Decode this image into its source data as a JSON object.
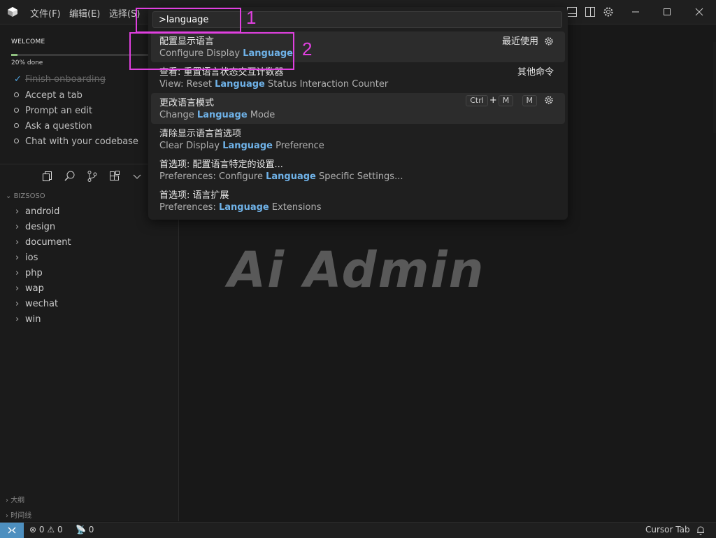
{
  "titlebar": {
    "menus": [
      "文件(F)",
      "编辑(E)",
      "选择(S)"
    ]
  },
  "welcome": {
    "title": "WELCOME",
    "progress_percent": 20,
    "progress_text": "20% done",
    "todos": [
      {
        "label": "Finish onboarding",
        "done": true
      },
      {
        "label": "Accept a tab",
        "done": false
      },
      {
        "label": "Prompt an edit",
        "done": false
      },
      {
        "label": "Ask a question",
        "done": false
      },
      {
        "label": "Chat with your codebase",
        "done": false
      }
    ]
  },
  "explorer": {
    "root": "BIZSOSO",
    "folders": [
      "android",
      "design",
      "document",
      "ios",
      "php",
      "wap",
      "wechat",
      "win"
    ],
    "bottom_sections": [
      "大纲",
      "时间线"
    ]
  },
  "palette": {
    "query": ">language",
    "items": [
      {
        "zh": "配置显示语言",
        "en_pre": "Configure Display ",
        "en_hl": "Language",
        "en_post": "",
        "right": "最近使用",
        "has_gear": true
      },
      {
        "zh": "查看: 重置语言状态交互计数器",
        "en_pre": "View: Reset ",
        "en_hl": "Language",
        "en_post": " Status Interaction Counter",
        "right": "其他命令",
        "has_gear": false
      },
      {
        "zh": "更改语言模式",
        "en_pre": "Change ",
        "en_hl": "Language",
        "en_post": " Mode",
        "keys": [
          "Ctrl",
          "+",
          "M",
          "M"
        ],
        "has_gear": true
      },
      {
        "zh": "清除显示语言首选项",
        "en_pre": "Clear Display ",
        "en_hl": "Language",
        "en_post": " Preference"
      },
      {
        "zh": "首选项: 配置语言特定的设置...",
        "en_pre": "Preferences: Configure ",
        "en_hl": "Language",
        "en_post": " Specific Settings..."
      },
      {
        "zh": "首选项: 语言扩展",
        "en_pre": "Preferences: ",
        "en_hl": "Language",
        "en_post": " Extensions"
      }
    ]
  },
  "annotations": [
    "1",
    "2"
  ],
  "watermark": "Ai Admin",
  "statusbar": {
    "errors": "0",
    "warnings": "0",
    "ports": "0",
    "cursor_tab": "Cursor Tab"
  }
}
